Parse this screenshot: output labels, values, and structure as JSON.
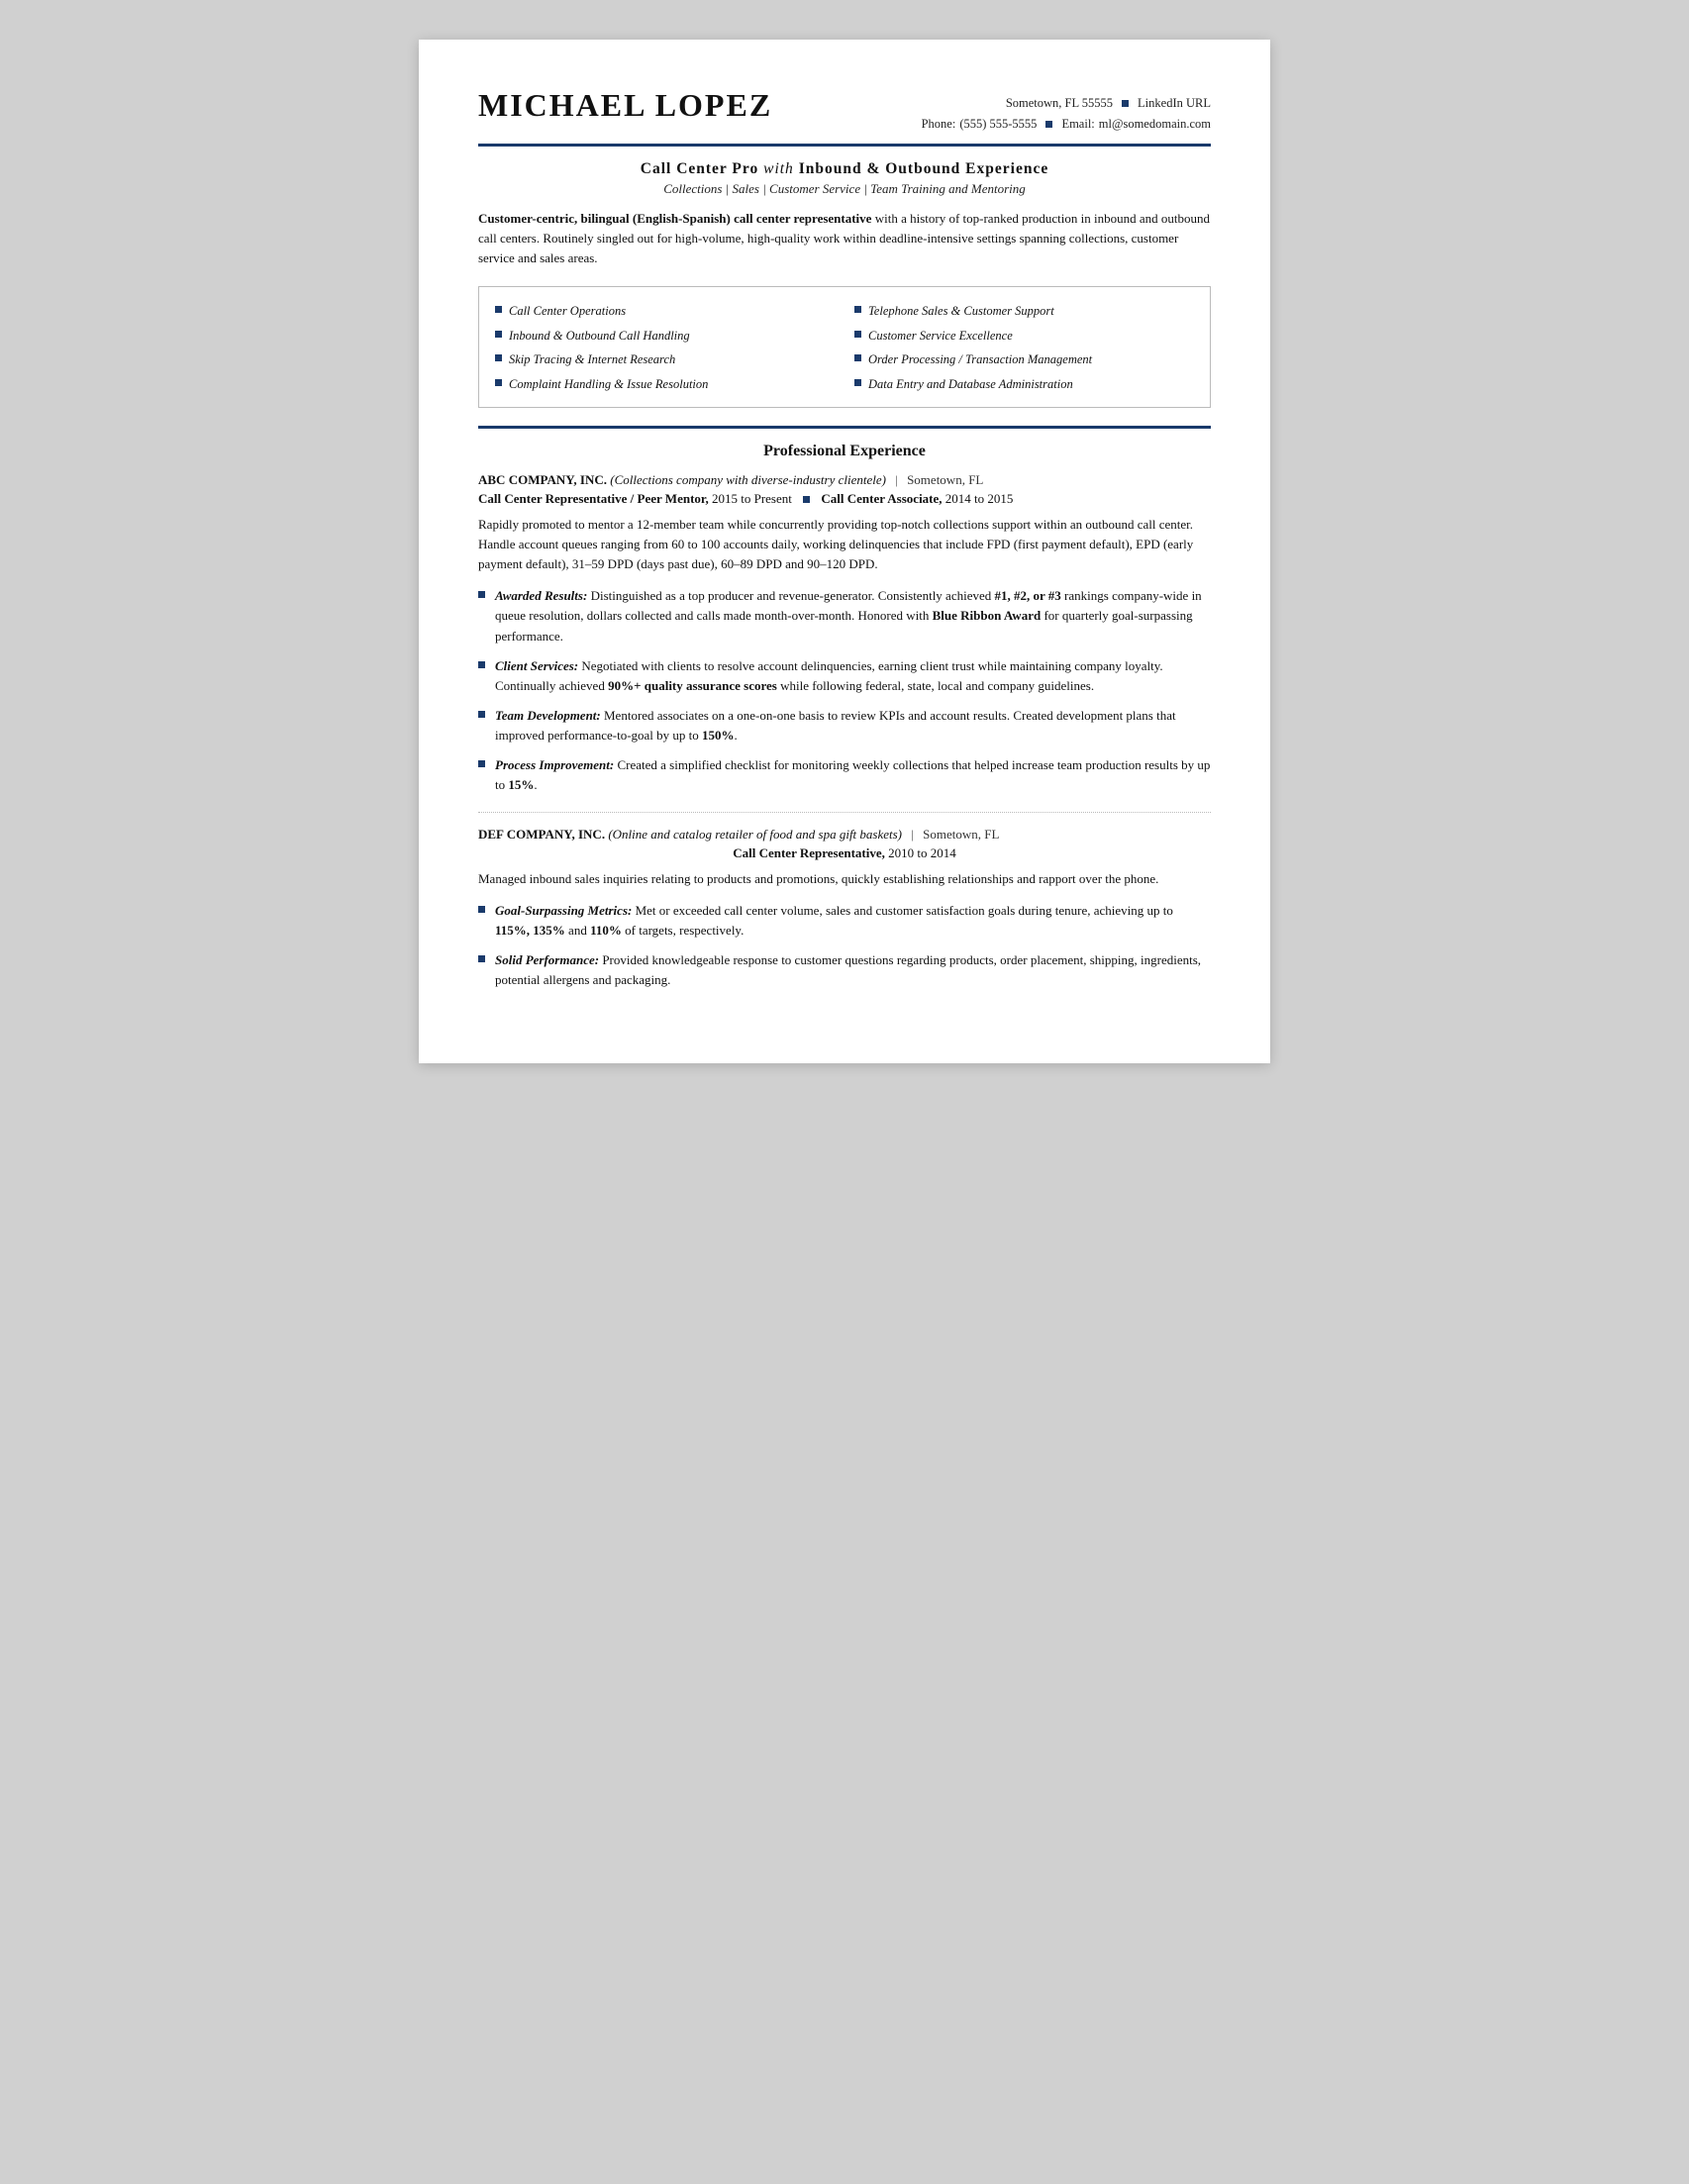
{
  "header": {
    "name": "Michael Lopez",
    "contact_line1": "Sometown, FL 55555",
    "contact_bullet1": "■",
    "linkedin": "LinkedIn URL",
    "phone_label": "Phone:",
    "phone": "(555) 555-5555",
    "contact_bullet2": "■",
    "email_label": "Email:",
    "email": "ml@somedomain.com"
  },
  "title": {
    "main": "Call Center Pro",
    "with_text": "with",
    "main2": "Inbound & Outbound Experience",
    "subtitle": "Collections | Sales | Customer Service | Team Training and Mentoring"
  },
  "summary": {
    "bold_part": "Customer-centric, bilingual (English-Spanish) call center representative",
    "rest": " with a history of top-ranked production in inbound and outbound call centers. Routinely singled out for high-volume, high-quality work within deadline-intensive settings spanning collections, customer service and sales areas."
  },
  "skills": {
    "left": [
      "Call Center Operations",
      "Inbound & Outbound Call Handling",
      "Skip Tracing & Internet Research",
      "Complaint Handling & Issue Resolution"
    ],
    "right": [
      "Telephone Sales & Customer Support",
      "Customer Service Excellence",
      "Order Processing / Transaction Management",
      "Data Entry and Database Administration"
    ]
  },
  "sections": {
    "professional_experience": "Professional Experience"
  },
  "companies": [
    {
      "name": "ABC COMPANY, INC.",
      "description": "(Collections company with diverse-industry clientele)",
      "location": "Sometown, FL",
      "roles": [
        {
          "title": "Call Center Representative / Peer Mentor,",
          "dates": "2015 to Present",
          "separator": "■",
          "title2": "Call Center Associate,",
          "dates2": "2014 to 2015"
        }
      ],
      "body": "Rapidly promoted to mentor a 12-member team while concurrently providing top-notch collections support within an outbound call center. Handle account queues ranging from 60 to 100 accounts daily, working delinquencies that include FPD (first payment default), EPD (early payment default), 31–59 DPD (days past due), 60–89 DPD and 90–120 DPD.",
      "bullets": [
        {
          "bold": "Awarded Results:",
          "text": " Distinguished as a top producer and revenue-generator. Consistently achieved ",
          "bold2": "#1, #2, or #3",
          "text2": " rankings company-wide in queue resolution, dollars collected and calls made month-over-month. Honored with ",
          "bold3": "Blue Ribbon Award",
          "text3": " for quarterly goal-surpassing performance."
        },
        {
          "bold": "Client Services:",
          "text": " Negotiated with clients to resolve account delinquencies, earning client trust while maintaining company loyalty. Continually achieved ",
          "bold2": "90%+ quality assurance scores",
          "text2": " while following federal, state, local and company guidelines."
        },
        {
          "bold": "Team Development:",
          "text": " Mentored associates on a one-on-one basis to review KPIs and account results. Created development plans that improved performance-to-goal by up to ",
          "bold2": "150%",
          "text2": "."
        },
        {
          "bold": "Process Improvement:",
          "text": " Created a simplified checklist for monitoring weekly collections that helped increase team production results by up to ",
          "bold2": "15%",
          "text2": "."
        }
      ]
    },
    {
      "name": "DEF COMPANY, INC.",
      "description": "(Online and catalog retailer of food and spa gift baskets)",
      "location": "Sometown, FL",
      "roles": [
        {
          "title": "Call Center Representative,",
          "dates": "2010 to 2014"
        }
      ],
      "body": "Managed inbound sales inquiries relating to products and promotions, quickly establishing relationships and rapport over the phone.",
      "bullets": [
        {
          "bold": "Goal-Surpassing Metrics:",
          "text": " Met or exceeded call center volume, sales and customer satisfaction goals during tenure, achieving up to ",
          "bold2": "115%, 135%",
          "text2": " and ",
          "bold3": "110%",
          "text3": " of targets, respectively."
        },
        {
          "bold": "Solid Performance:",
          "text": " Provided knowledgeable response to customer questions regarding products, order placement, shipping, ingredients, potential allergens and packaging."
        }
      ]
    }
  ]
}
